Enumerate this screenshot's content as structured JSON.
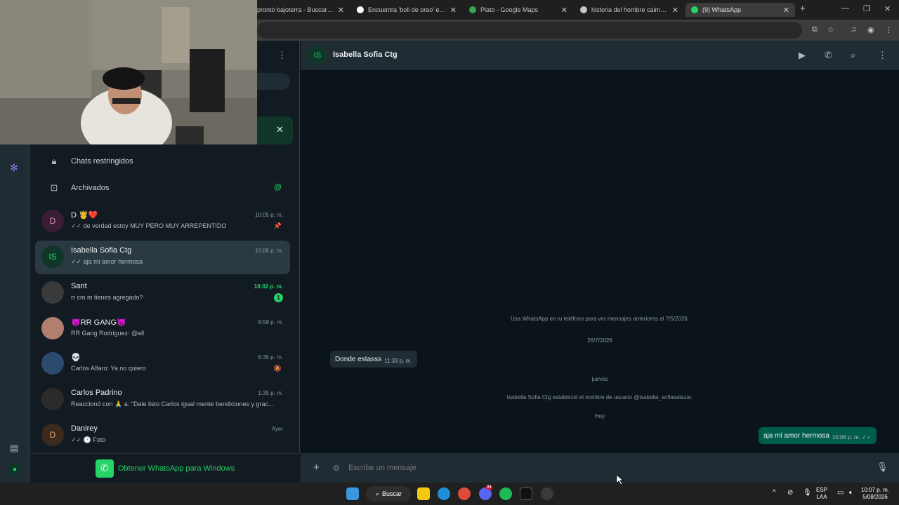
{
  "browser": {
    "tabs": [
      {
        "label": "pronto bajoterra - Buscar con G",
        "favicon_color": "#4285f4"
      },
      {
        "label": "Encuentra 'boli de oreo' en TikT",
        "favicon_color": "#ffffff"
      },
      {
        "label": "Plato - Google Maps",
        "favicon_color": "#34a853"
      },
      {
        "label": "historia del hombre caimán - B",
        "favicon_color": "#c4c7c5"
      },
      {
        "label": "(9) WhatsApp",
        "favicon_color": "#25d366"
      }
    ]
  },
  "sidebar": {
    "restricted_label": "Chats restringidos",
    "archived_label": "Archivados",
    "archived_badge": "@",
    "chats": [
      {
        "avatar": "D",
        "avatar_bg": "#3b1d35",
        "avatar_fg": "#e68bc3",
        "name": "D 🤴❤️",
        "time": "10:05 p. m.",
        "preview": "✓✓ de verdad estoy MUY PERO MUY ARREPENTIDO",
        "icon": "📌"
      },
      {
        "avatar": "IS",
        "avatar_bg": "#103629",
        "avatar_fg": "#25d366",
        "name": "Isabella Sofia Ctg",
        "time": "10:06 p. m.",
        "preview": "✓✓ aja mi amor hermosa"
      },
      {
        "avatar": "",
        "avatar_bg": "#3a3a3a",
        "avatar_fg": "#ffffff",
        "name": "Sant",
        "time": "10:02 p. m.",
        "preview": "rr cm m tienes agregado?",
        "unread": "1"
      },
      {
        "avatar": "",
        "avatar_bg": "#b07f6e",
        "avatar_fg": "#ffffff",
        "name": "😈RR GANG😈",
        "time": "8:59 p. m.",
        "preview": "RR Gang Rodriguez: @all"
      },
      {
        "avatar": "",
        "avatar_bg": "#2c4a6e",
        "avatar_fg": "#ffffff",
        "name": "💀",
        "time": "8:35 p. m.",
        "preview": "Carlos Alfaro: Ya no quiero",
        "icon": "🔕"
      },
      {
        "avatar": "",
        "avatar_bg": "#2b2b2b",
        "avatar_fg": "#ffffff",
        "name": "Carlos Padrino",
        "time": "1:35 p. m.",
        "preview": "Reaccionó con 🙏 a: \"Dale listo Carlos igual mente bendiciones y grac..."
      },
      {
        "avatar": "D",
        "avatar_bg": "#3b2a1d",
        "avatar_fg": "#e6a56b",
        "name": "Danirey",
        "time": "Ayer",
        "preview": "✓✓ 🕒 Foto"
      }
    ],
    "get_windows": "Obtener WhatsApp para Windows"
  },
  "chat": {
    "contact_initials": "IS",
    "contact_name": "Isabella Sofia Ctg",
    "older_notice": "Usa WhatsApp en tu teléfono para ver mensajes anteriores al 7/5/2026.",
    "date1": "26/7/2026",
    "msg1_text": "Donde estasss",
    "msg1_time": "11:33 p. m.",
    "date2": "jueves",
    "username_notice": "Isabella Sofia Ctg estableció el nombre de usuario @isabella_sofiasalazar.",
    "date3": "Hoy",
    "msg2_text": "aja mi amor hermosa",
    "msg2_time": "10:06 p. m. ✓✓",
    "composer_placeholder": "Escribe un mensaje"
  },
  "taskbar": {
    "search_label": "Buscar",
    "lang_line1": "ESP",
    "lang_line2": "LAA",
    "clock_time": "10:07 p. m.",
    "clock_date": "5/08/2026",
    "discord_badge": "94"
  }
}
